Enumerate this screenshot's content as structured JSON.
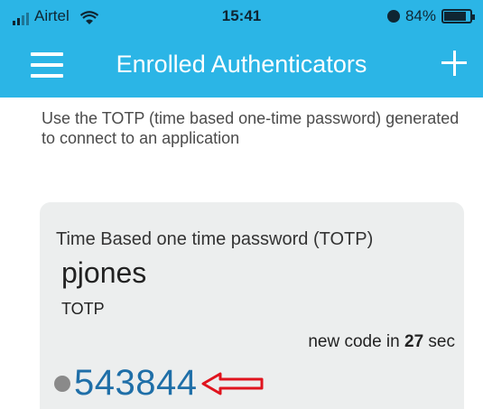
{
  "status_bar": {
    "carrier": "Airtel",
    "time": "15:41",
    "battery_label": "84%",
    "battery_level": 0.84
  },
  "app_bar": {
    "title": "Enrolled Authenticators",
    "menu_icon": "hamburger-menu-icon",
    "add_icon": "plus-icon"
  },
  "description": "Use the TOTP (time based one-time password) generated to connect to an application",
  "authenticator": {
    "type_label": "Time Based one time password (TOTP)",
    "username": "pjones",
    "kind": "TOTP",
    "countdown_prefix": "new code in",
    "countdown_seconds": "27",
    "countdown_suffix": "sec",
    "code": "543844",
    "arrow_color": "#e0141e",
    "code_color": "#1f6fa8"
  },
  "colors": {
    "accent": "#2bb5e6",
    "card_bg": "#eceeee"
  }
}
